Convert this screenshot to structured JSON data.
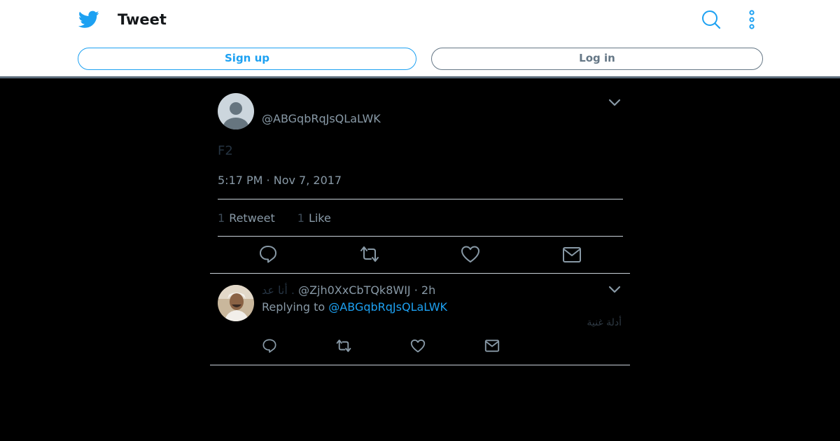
{
  "header": {
    "title": "Tweet",
    "signup_label": "Sign up",
    "login_label": "Log in",
    "brand_color": "#1da1f2"
  },
  "tweet": {
    "handle": "@ABGqbRqJsQLaLWK",
    "text": "F2",
    "timestamp": "5:17 PM · Nov 7, 2017",
    "retweet_count": "1",
    "retweet_label": "Retweet",
    "like_count": "1",
    "like_label": "Like"
  },
  "reply": {
    "name": "أنا عد .",
    "handle": "@Zjh0XxCbTQk8WIJ",
    "time": "· 2h",
    "replying_prefix": "Replying to",
    "replying_handle": "@ABGqbRqJsQLaLWK",
    "text": "أدلة غنية"
  },
  "icons": [
    "twitter-bird-icon",
    "search-icon",
    "more-icon",
    "chevron-down-icon",
    "reply-icon",
    "retweet-icon",
    "like-icon",
    "message-icon"
  ]
}
